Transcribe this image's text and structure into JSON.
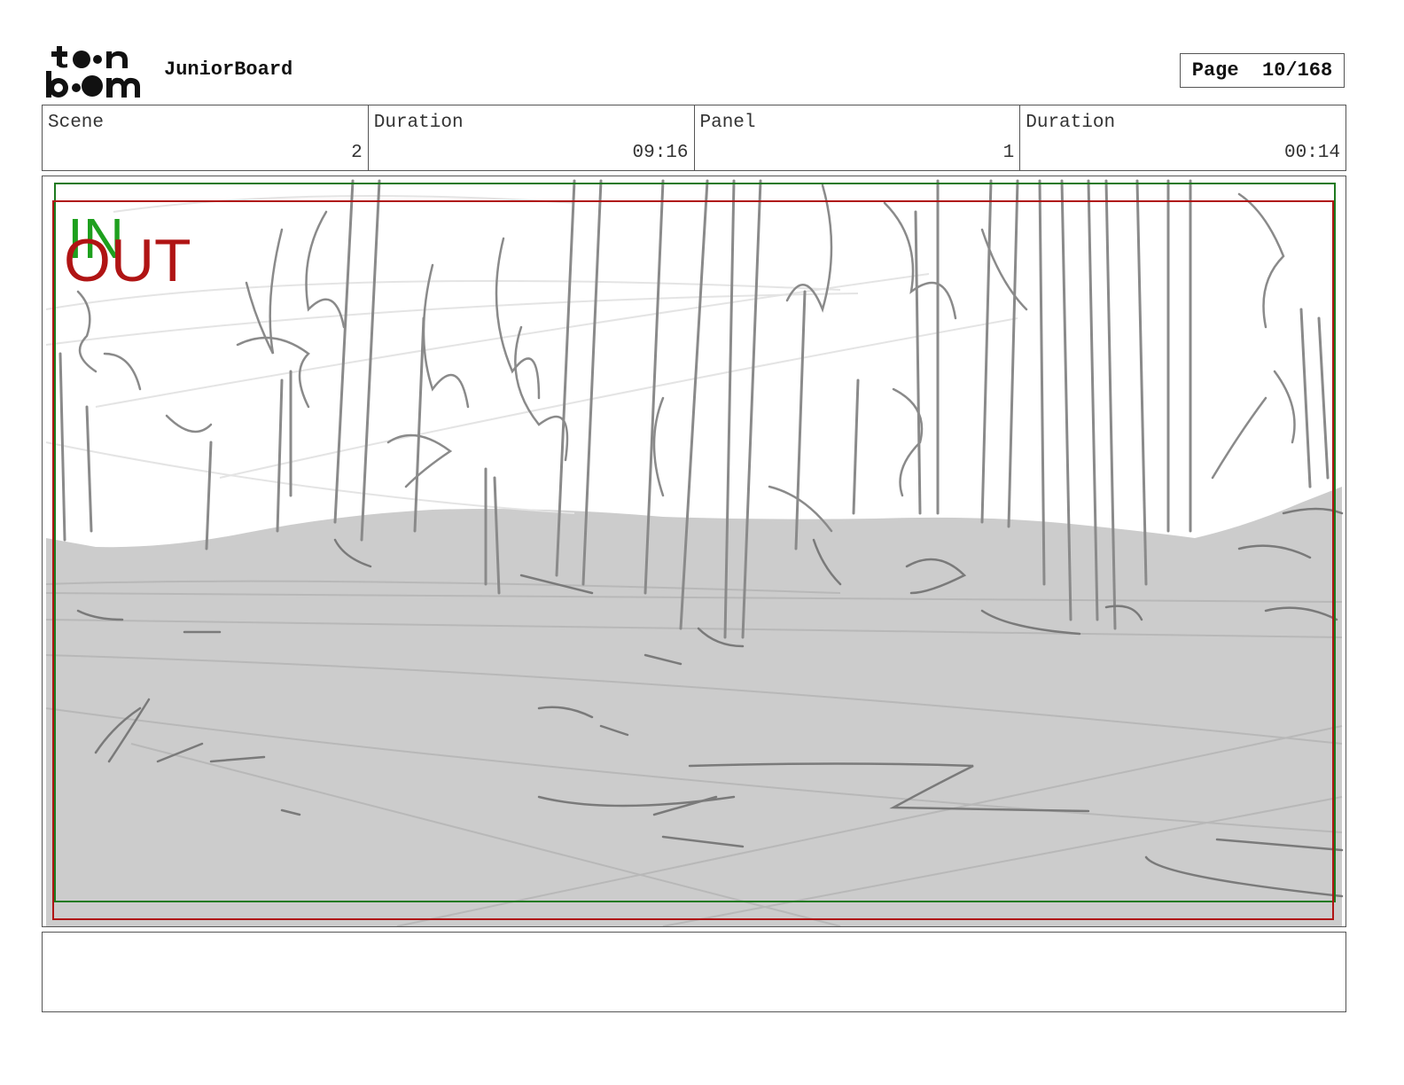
{
  "header": {
    "logo_text": "toon boom",
    "app_name": "JuniorBoard",
    "page_label": "Page  10/168"
  },
  "info": {
    "scene_label": "Scene",
    "scene_value": "2",
    "scene_duration_label": "Duration",
    "scene_duration_value": "09:16",
    "panel_label": "Panel",
    "panel_value": "1",
    "panel_duration_label": "Duration",
    "panel_duration_value": "00:14"
  },
  "panel": {
    "in_marker": "IN",
    "out_marker": "OUT",
    "in_color": "#1ea01e",
    "out_color": "#b01414",
    "ground_color": "#cccccc",
    "sketch_color": "#7a7a7a"
  },
  "notes": {
    "text": ""
  }
}
